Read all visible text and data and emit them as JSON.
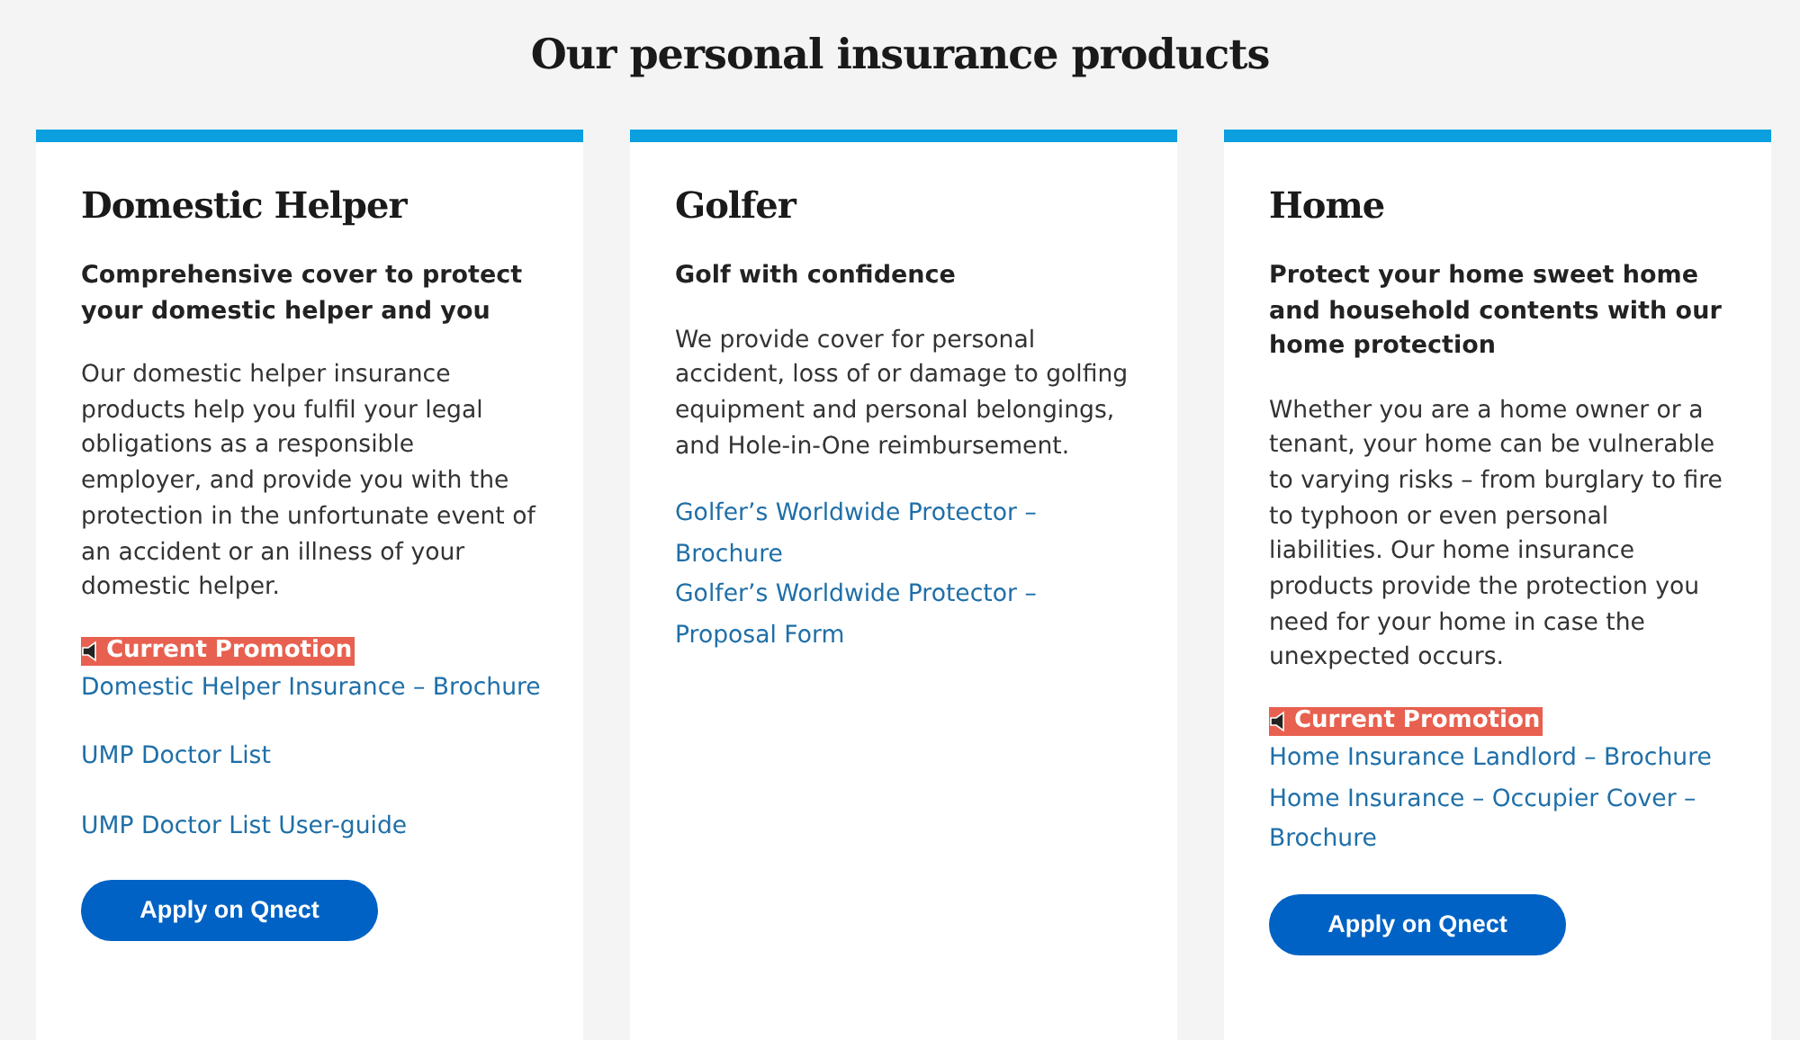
{
  "page_title": "Our personal insurance products",
  "cards": [
    {
      "title": "Domestic Helper",
      "subtitle": "Comprehensive cover to protect your domestic helper and you",
      "description": "Our domestic helper insurance products help you fulfil your legal obligations as a responsible employer, and provide you with the protection in the unfortunate event of an accident or an illness of your domestic helper.",
      "sections": [
        {
          "promotion": "Current Promotion",
          "links": [
            "Domestic Helper Insurance – Brochure"
          ]
        },
        {
          "links": [
            "UMP Doctor List"
          ]
        },
        {
          "links": [
            "UMP Doctor List User-guide"
          ]
        }
      ],
      "button": "Apply on Qnect"
    },
    {
      "title": "Golfer",
      "subtitle": "Golf with confidence",
      "description": "We provide cover for personal accident, loss of or damage to golfing equipment and personal belongings, and Hole-in-One reimbursement.",
      "sections": [
        {
          "links": [
            "Golfer’s Worldwide Protector – Brochure",
            "Golfer’s Worldwide Protector – Proposal Form"
          ]
        }
      ]
    },
    {
      "title": "Home",
      "subtitle": "Protect your home sweet home and household contents with our home protection",
      "description": "Whether you are a home owner or a tenant, your home can be vulnerable to varying risks – from burglary to fire to typhoon or even personal liabilities. Our home insurance products provide the protection you need for your home in case the unexpected occurs.",
      "sections": [
        {
          "promotion": "Current Promotion",
          "links": [
            "Home Insurance Landlord – Brochure",
            "Home Insurance – Occupier Cover – Brochure"
          ]
        }
      ],
      "button": "Apply on Qnect"
    }
  ]
}
